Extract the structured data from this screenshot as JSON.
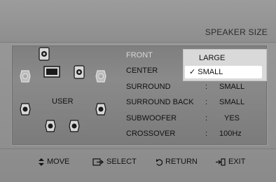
{
  "header": {
    "title": "SPEAKER SIZE"
  },
  "diagram": {
    "user_label": "USER"
  },
  "menu": {
    "items": [
      {
        "label": "FRONT",
        "value": ""
      },
      {
        "label": "CENTER",
        "value": ""
      },
      {
        "label": "SURROUND",
        "value": "SMALL"
      },
      {
        "label": "SURROUND BACK",
        "value": "SMALL"
      },
      {
        "label": "SUBWOOFER",
        "value": "YES"
      },
      {
        "label": "CROSSOVER",
        "value": "100Hz"
      }
    ],
    "separator": ":"
  },
  "popup": {
    "options": [
      "LARGE",
      "SMALL"
    ],
    "selected": "SMALL",
    "check_mark": "✓"
  },
  "footer": {
    "move": "MOVE",
    "select": "SELECT",
    "return": "RETURN",
    "exit": "EXIT"
  }
}
